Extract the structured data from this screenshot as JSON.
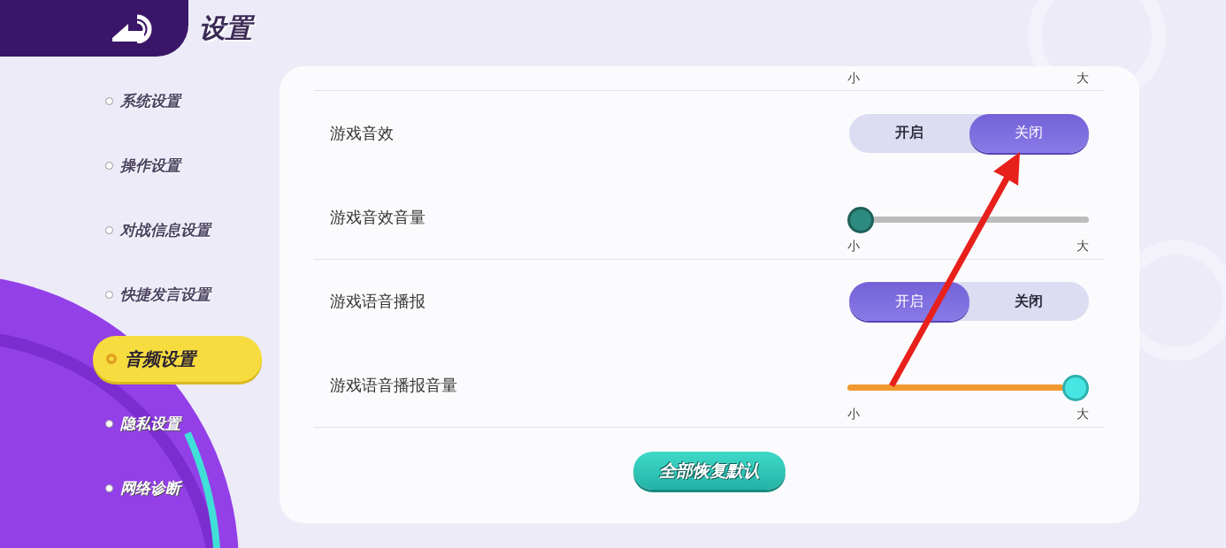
{
  "header": {
    "title": "设置"
  },
  "sidebar": {
    "items": [
      {
        "label": "系统设置",
        "selected": false
      },
      {
        "label": "操作设置",
        "selected": false
      },
      {
        "label": "对战信息设置",
        "selected": false
      },
      {
        "label": "快捷发言设置",
        "selected": false
      },
      {
        "label": "音频设置",
        "selected": true
      },
      {
        "label": "隐私设置",
        "selected": false
      },
      {
        "label": "网络诊断",
        "selected": false
      }
    ]
  },
  "settings": {
    "rows": [
      {
        "kind": "scale",
        "min_label": "小",
        "max_label": "大"
      },
      {
        "kind": "toggle",
        "label": "游戏音效",
        "options": [
          {
            "label": "开启",
            "selected": false
          },
          {
            "label": "关闭",
            "selected": true
          }
        ]
      },
      {
        "kind": "slider",
        "label": "游戏音效音量",
        "level": 0,
        "min_label": "小",
        "max_label": "大"
      },
      {
        "kind": "toggle",
        "label": "游戏语音播报",
        "options": [
          {
            "label": "开启",
            "selected": true
          },
          {
            "label": "关闭",
            "selected": false
          }
        ]
      },
      {
        "kind": "slider",
        "label": "游戏语音播报音量",
        "level": 1,
        "min_label": "小",
        "max_label": "大"
      }
    ],
    "reset_button": "全部恢复默认"
  }
}
